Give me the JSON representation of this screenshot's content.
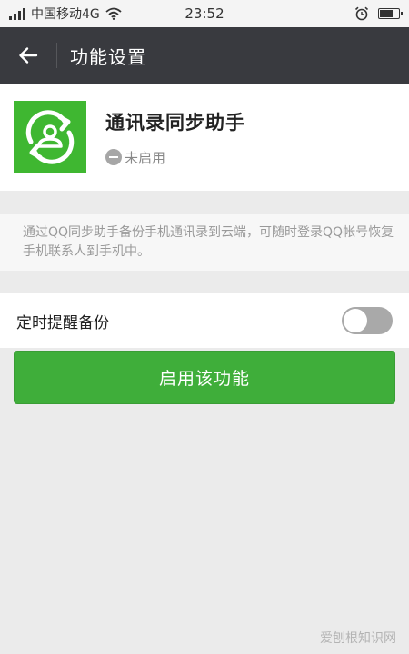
{
  "status_bar": {
    "carrier": "中国移动4G",
    "time": "23:52",
    "battery_level": 0.75
  },
  "header": {
    "title": "功能设置"
  },
  "plugin": {
    "name": "通讯录同步助手",
    "status": "未启用",
    "accent_color": "#3fb731"
  },
  "description": "通过QQ同步助手备份手机通讯录到云端，可随时登录QQ帐号恢复手机联系人到手机中。",
  "reminder": {
    "label": "定时提醒备份",
    "enabled": false
  },
  "enable_button": {
    "label": "启用该功能"
  },
  "watermark": "爱刨根知识网",
  "icons": [
    "signal-icon",
    "wifi-icon",
    "alarm-icon",
    "battery-icon",
    "back-arrow-icon",
    "contact-sync-icon",
    "disabled-status-icon"
  ]
}
